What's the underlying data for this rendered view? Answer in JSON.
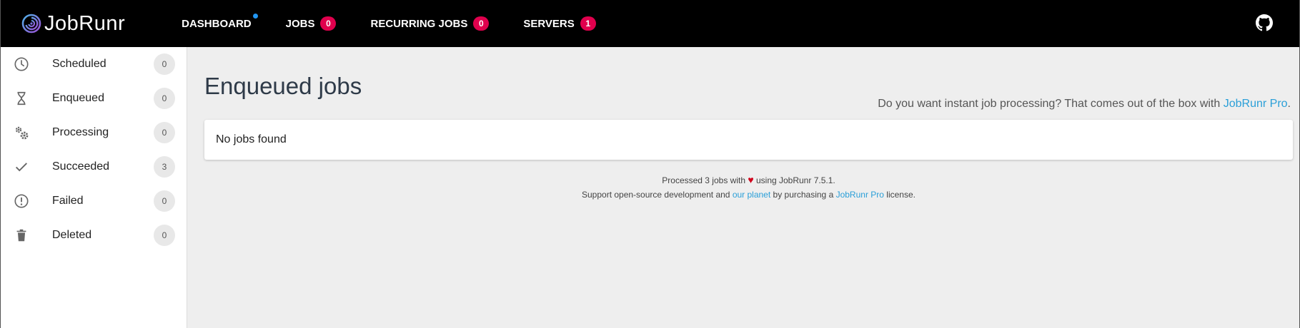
{
  "brand": {
    "name": "JobRunr"
  },
  "nav": [
    {
      "label": "DASHBOARD",
      "badge": null,
      "dot": true
    },
    {
      "label": "JOBS",
      "badge": "0",
      "dot": false
    },
    {
      "label": "RECURRING JOBS",
      "badge": "0",
      "dot": false
    },
    {
      "label": "SERVERS",
      "badge": "1",
      "dot": false
    }
  ],
  "sidebar": {
    "items": [
      {
        "label": "Scheduled",
        "count": "0",
        "icon": "clock-icon"
      },
      {
        "label": "Enqueued",
        "count": "0",
        "icon": "hourglass-icon"
      },
      {
        "label": "Processing",
        "count": "0",
        "icon": "gears-icon"
      },
      {
        "label": "Succeeded",
        "count": "3",
        "icon": "check-icon"
      },
      {
        "label": "Failed",
        "count": "0",
        "icon": "alert-circle-icon"
      },
      {
        "label": "Deleted",
        "count": "0",
        "icon": "trash-icon"
      }
    ]
  },
  "main": {
    "title": "Enqueued jobs",
    "promo_text": "Do you want instant job processing? That comes out of the box with ",
    "promo_link": "JobRunr Pro",
    "promo_end": ".",
    "empty_message": "No jobs found"
  },
  "footer": {
    "line1_a": "Processed 3 jobs with ",
    "heart": "♥",
    "line1_b": " using JobRunr 7.5.1.",
    "line2_a": "Support open-source development and ",
    "line2_link1": "our planet",
    "line2_b": " by purchasing a ",
    "line2_link2": "JobRunr Pro",
    "line2_c": " license."
  },
  "colors": {
    "topbar": "#000000",
    "badge": "#e0004d",
    "link": "#2a9fd8",
    "background": "#eeeeee"
  }
}
